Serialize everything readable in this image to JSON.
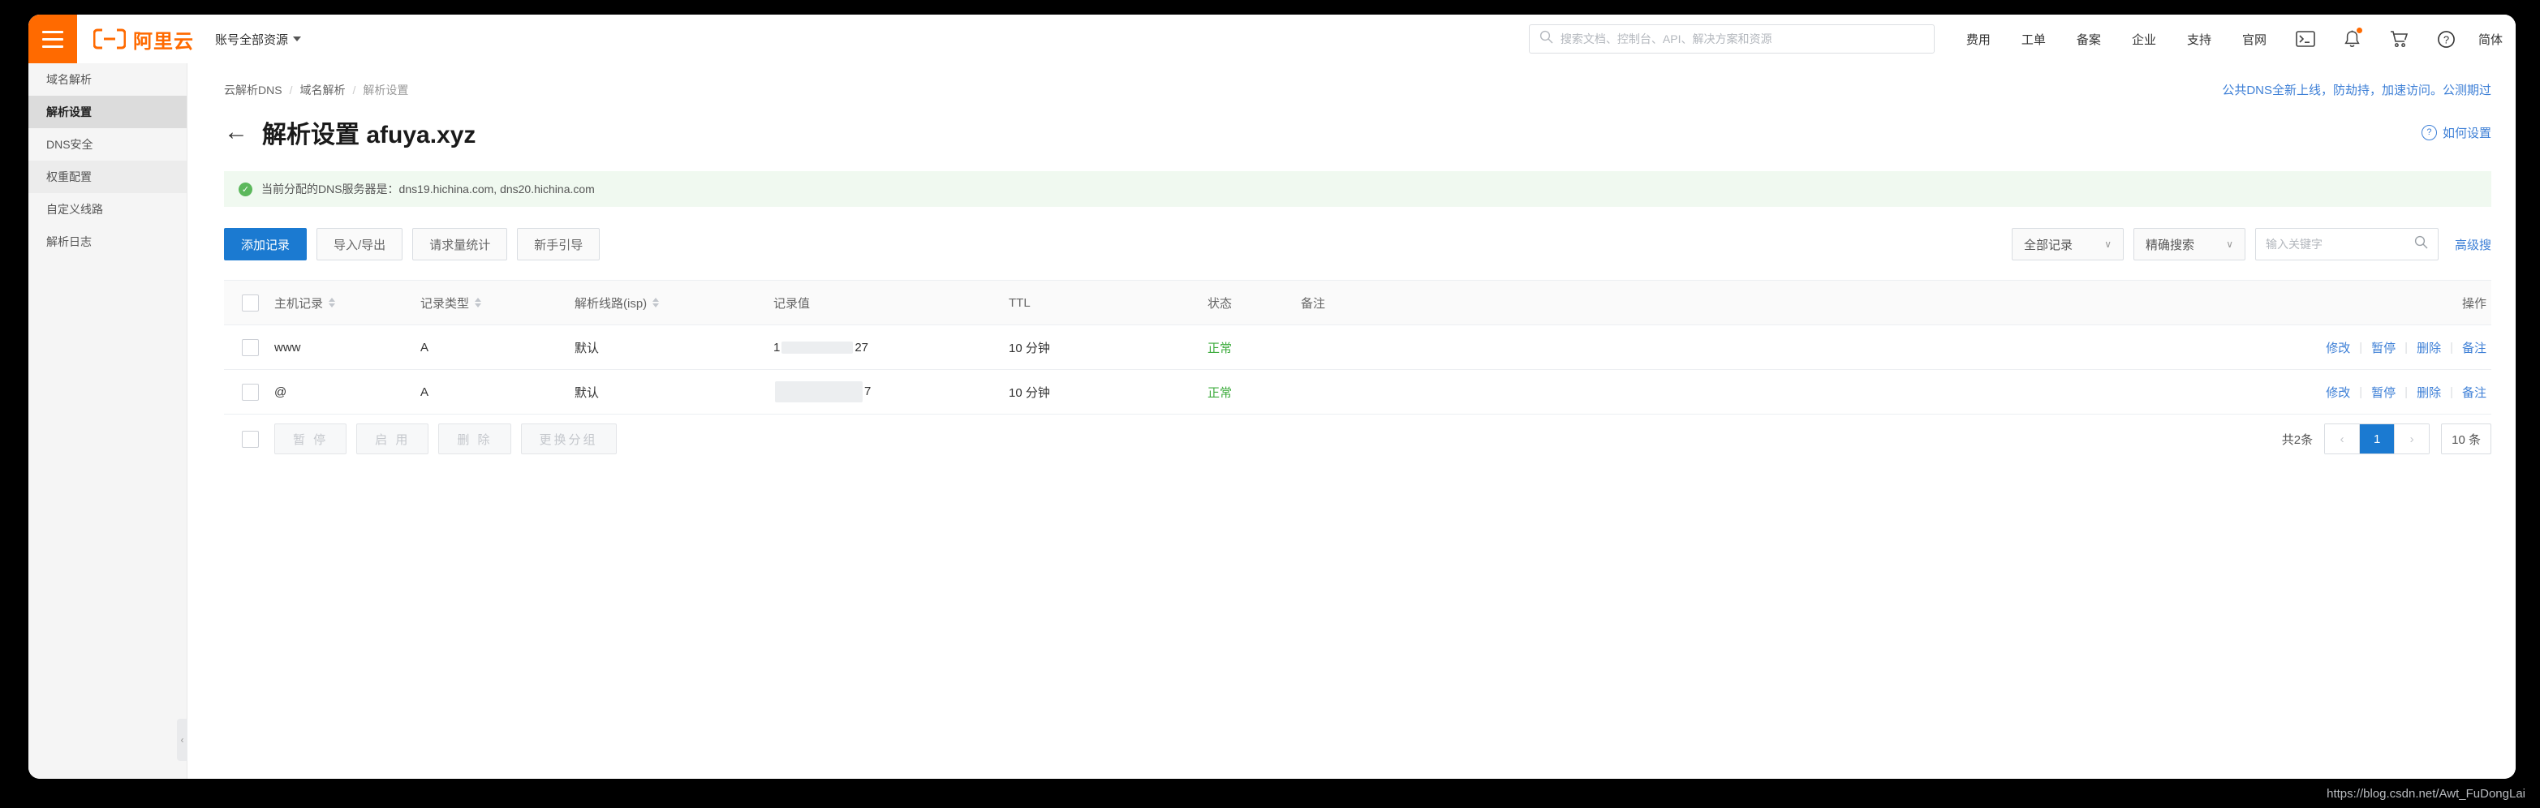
{
  "topbar": {
    "menu_icon": "hamburger-icon",
    "brand": "阿里云",
    "account_scope": "账号全部资源",
    "search_placeholder": "搜索文档、控制台、API、解决方案和资源",
    "nav": [
      {
        "label": "费用"
      },
      {
        "label": "工单"
      },
      {
        "label": "备案"
      },
      {
        "label": "企业"
      },
      {
        "label": "支持"
      },
      {
        "label": "官网"
      }
    ],
    "icons": [
      {
        "name": "terminal-icon",
        "glyph": "▣"
      },
      {
        "name": "bell-icon",
        "glyph": "🔔"
      },
      {
        "name": "cart-icon",
        "glyph": "🛒"
      },
      {
        "name": "help-icon",
        "glyph": "?"
      }
    ],
    "language": "简体"
  },
  "sidebar": {
    "items": [
      {
        "label": "域名解析",
        "active": false
      },
      {
        "label": "解析设置",
        "active": true
      },
      {
        "label": "DNS安全",
        "active": false
      },
      {
        "label": "权重配置",
        "active": false
      },
      {
        "label": "自定义线路",
        "active": false
      },
      {
        "label": "解析日志",
        "active": false
      }
    ],
    "collapse_glyph": "‹"
  },
  "breadcrumb": {
    "items": [
      "云解析DNS",
      "域名解析",
      "解析设置"
    ],
    "separator": "/"
  },
  "promo": {
    "text": "公共DNS全新上线，防劫持，加速访问。公测期过"
  },
  "page": {
    "back_glyph": "←",
    "title": "解析设置 afuya.xyz",
    "help_label": "如何设置",
    "help_glyph": "?"
  },
  "notice": {
    "icon_glyph": "✓",
    "text": "当前分配的DNS服务器是：dns19.hichina.com, dns20.hichina.com"
  },
  "toolbar": {
    "add_record": "添加记录",
    "import_export": "导入/导出",
    "request_stats": "请求量统计",
    "beginner_guide": "新手引导",
    "record_filter": "全部记录",
    "search_mode": "精确搜索",
    "search_placeholder": "输入关键字",
    "search_icon": "search-icon",
    "advanced_search": "高级搜"
  },
  "table": {
    "columns": [
      {
        "key": "host",
        "label": "主机记录",
        "sortable": true
      },
      {
        "key": "type",
        "label": "记录类型",
        "sortable": true
      },
      {
        "key": "line",
        "label": "解析线路(isp)",
        "sortable": true
      },
      {
        "key": "value",
        "label": "记录值",
        "sortable": false
      },
      {
        "key": "ttl",
        "label": "TTL",
        "sortable": false
      },
      {
        "key": "status",
        "label": "状态",
        "sortable": false
      },
      {
        "key": "note",
        "label": "备注",
        "sortable": false
      },
      {
        "key": "ops",
        "label": "操作",
        "sortable": false
      }
    ],
    "rows": [
      {
        "host": "www",
        "type": "A",
        "line": "默认",
        "value_prefix": "1",
        "value_suffix": "27",
        "ttl": "10 分钟",
        "status": "正常",
        "note": ""
      },
      {
        "host": "@",
        "type": "A",
        "line": "默认",
        "value_prefix": "",
        "value_suffix": "7",
        "ttl": "10 分钟",
        "status": "正常",
        "note": ""
      }
    ],
    "row_actions": [
      "修改",
      "暂停",
      "删除",
      "备注"
    ],
    "action_separator": "|"
  },
  "footer": {
    "bulk_actions": [
      "暂 停",
      "启 用",
      "删 除",
      "更换分组"
    ],
    "total": "共2条",
    "prev_glyph": "‹",
    "next_glyph": "›",
    "current_page": "1",
    "page_size": "10 条"
  },
  "statusbar": {
    "url": "https://blog.csdn.net/Awt_FuDongLai"
  }
}
